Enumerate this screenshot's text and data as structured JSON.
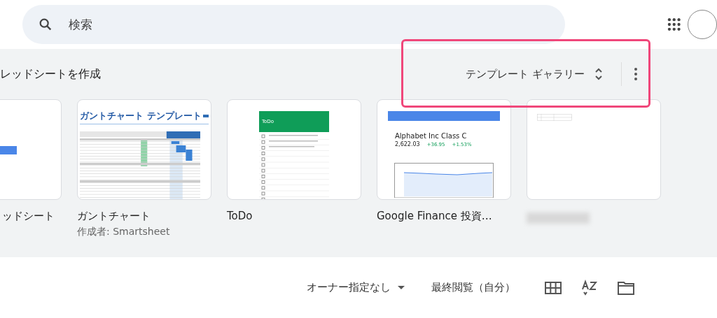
{
  "search": {
    "placeholder": "検索"
  },
  "templates": {
    "title": "レッドシートを作成",
    "gallery_button": "テンプレート ギャラリー",
    "items": [
      {
        "kind": "blank",
        "title": "ッドシート"
      },
      {
        "kind": "gantt",
        "title": "ガントチャート",
        "subtitle": "作成者: Smartsheet",
        "preview_title": "ガントチャート テンプレート"
      },
      {
        "kind": "todo",
        "title": "ToDo",
        "preview_title": "ToDo"
      },
      {
        "kind": "finance",
        "title": "Google Finance 投資…",
        "preview_title": "Alphabet Inc Class C",
        "preview_value": "2,622.03",
        "preview_changes": [
          "+36.95",
          "+1.53%"
        ]
      },
      {
        "kind": "table"
      }
    ]
  },
  "toolbar": {
    "owner_filter": "オーナー指定なし",
    "sort": "最終閲覧（自分）"
  }
}
